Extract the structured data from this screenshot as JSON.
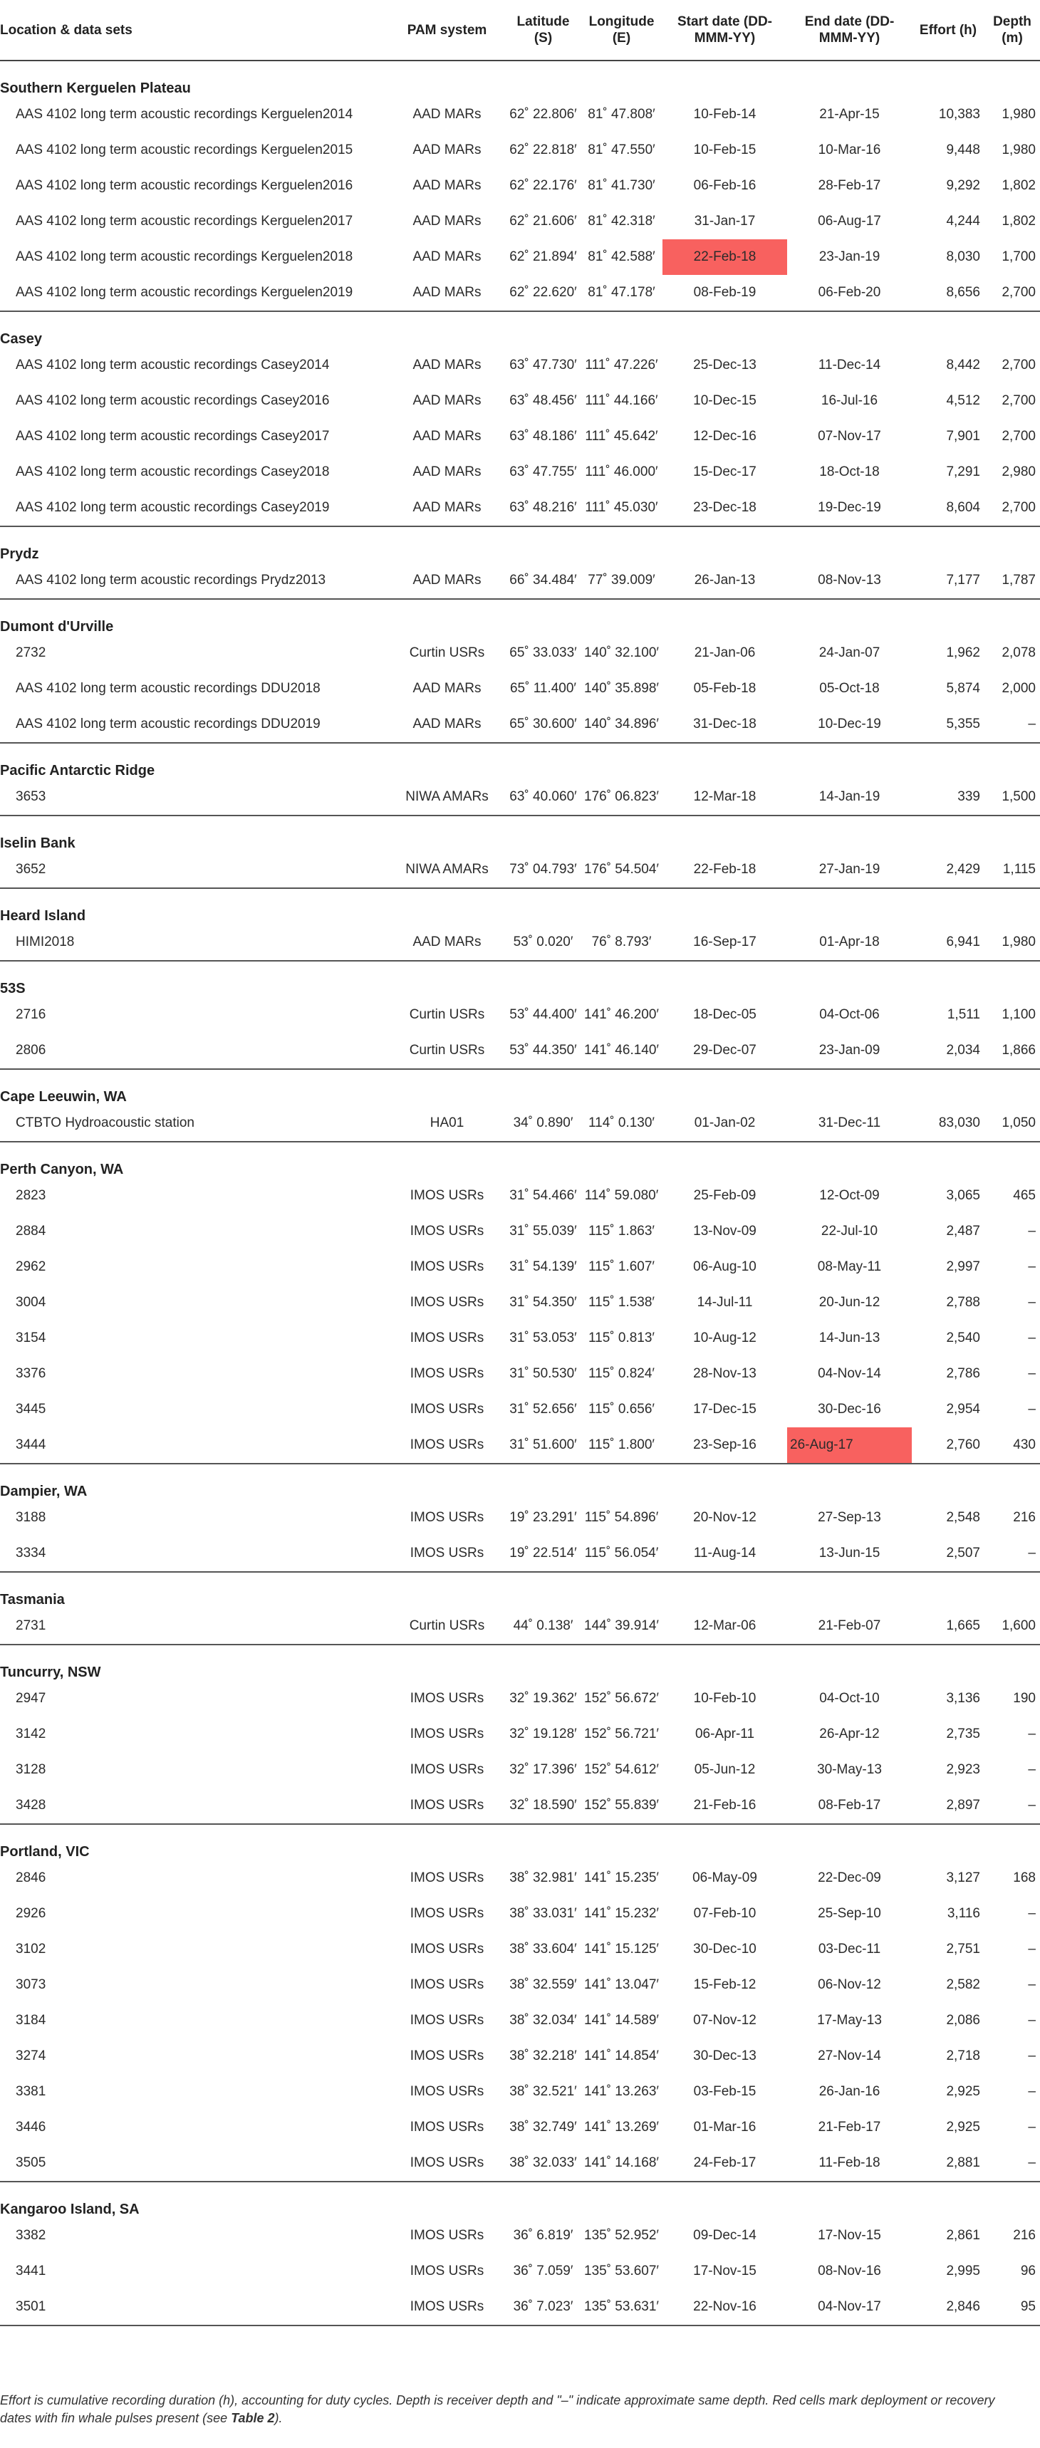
{
  "headers": {
    "location": "Location & data sets",
    "pam": "PAM system",
    "lat": "Latitude (S)",
    "lon": "Longitude (E)",
    "start": "Start date (DD-MMM-YY)",
    "end": "End date (DD-MMM-YY)",
    "effort": "Effort (h)",
    "depth": "Depth (m)"
  },
  "sections": [
    {
      "name": "Southern Kerguelen Plateau",
      "rows": [
        {
          "loc": "AAS 4102 long term acoustic recordings Kerguelen2014",
          "pam": "AAD MARs",
          "lat": "62˚ 22.806′",
          "lon": "81˚ 47.808′",
          "start": "10-Feb-14",
          "end": "21-Apr-15",
          "effort": "10,383",
          "depth": "1,980"
        },
        {
          "loc": "AAS 4102 long term acoustic recordings Kerguelen2015",
          "pam": "AAD MARs",
          "lat": "62˚ 22.818′",
          "lon": "81˚ 47.550′",
          "start": "10-Feb-15",
          "end": "10-Mar-16",
          "effort": "9,448",
          "depth": "1,980"
        },
        {
          "loc": "AAS 4102 long term acoustic recordings Kerguelen2016",
          "pam": "AAD MARs",
          "lat": "62˚ 22.176′",
          "lon": "81˚ 41.730′",
          "start": "06-Feb-16",
          "end": "28-Feb-17",
          "effort": "9,292",
          "depth": "1,802"
        },
        {
          "loc": "AAS 4102 long term acoustic recordings Kerguelen2017",
          "pam": "AAD MARs",
          "lat": "62˚ 21.606′",
          "lon": "81˚ 42.318′",
          "start": "31-Jan-17",
          "end": "06-Aug-17",
          "effort": "4,244",
          "depth": "1,802"
        },
        {
          "loc": "AAS 4102 long term acoustic recordings Kerguelen2018",
          "pam": "AAD MARs",
          "lat": "62˚ 21.894′",
          "lon": "81˚ 42.588′",
          "start": "22-Feb-18",
          "end": "23-Jan-19",
          "effort": "8,030",
          "depth": "1,700",
          "red": "start"
        },
        {
          "loc": "AAS 4102 long term acoustic recordings Kerguelen2019",
          "pam": "AAD MARs",
          "lat": "62˚ 22.620′",
          "lon": "81˚ 47.178′",
          "start": "08-Feb-19",
          "end": "06-Feb-20",
          "effort": "8,656",
          "depth": "2,700"
        }
      ]
    },
    {
      "name": "Casey",
      "rows": [
        {
          "loc": "AAS 4102 long term acoustic recordings Casey2014",
          "pam": "AAD MARs",
          "lat": "63˚ 47.730′",
          "lon": "111˚ 47.226′",
          "start": "25-Dec-13",
          "end": "11-Dec-14",
          "effort": "8,442",
          "depth": "2,700"
        },
        {
          "loc": "AAS 4102 long term acoustic recordings Casey2016",
          "pam": "AAD MARs",
          "lat": "63˚ 48.456′",
          "lon": "111˚ 44.166′",
          "start": "10-Dec-15",
          "end": "16-Jul-16",
          "effort": "4,512",
          "depth": "2,700"
        },
        {
          "loc": "AAS 4102 long term acoustic recordings Casey2017",
          "pam": "AAD MARs",
          "lat": "63˚ 48.186′",
          "lon": "111˚ 45.642′",
          "start": "12-Dec-16",
          "end": "07-Nov-17",
          "effort": "7,901",
          "depth": "2,700"
        },
        {
          "loc": "AAS 4102 long term acoustic recordings Casey2018",
          "pam": "AAD MARs",
          "lat": "63˚ 47.755′",
          "lon": "111˚ 46.000′",
          "start": "15-Dec-17",
          "end": "18-Oct-18",
          "effort": "7,291",
          "depth": "2,980"
        },
        {
          "loc": "AAS 4102 long term acoustic recordings Casey2019",
          "pam": "AAD MARs",
          "lat": "63˚ 48.216′",
          "lon": "111˚ 45.030′",
          "start": "23-Dec-18",
          "end": "19-Dec-19",
          "effort": "8,604",
          "depth": "2,700"
        }
      ]
    },
    {
      "name": "Prydz",
      "rows": [
        {
          "loc": "AAS 4102 long term acoustic recordings Prydz2013",
          "pam": "AAD MARs",
          "lat": "66˚ 34.484′",
          "lon": "77˚ 39.009′",
          "start": "26-Jan-13",
          "end": "08-Nov-13",
          "effort": "7,177",
          "depth": "1,787"
        }
      ]
    },
    {
      "name": "Dumont d'Urville",
      "rows": [
        {
          "loc": "2732",
          "pam": "Curtin USRs",
          "lat": "65˚ 33.033′",
          "lon": "140˚ 32.100′",
          "start": "21-Jan-06",
          "end": "24-Jan-07",
          "effort": "1,962",
          "depth": "2,078"
        },
        {
          "loc": "AAS 4102 long term acoustic recordings DDU2018",
          "pam": "AAD MARs",
          "lat": "65˚ 11.400′",
          "lon": "140˚ 35.898′",
          "start": "05-Feb-18",
          "end": "05-Oct-18",
          "effort": "5,874",
          "depth": "2,000"
        },
        {
          "loc": "AAS 4102 long term acoustic recordings DDU2019",
          "pam": "AAD MARs",
          "lat": "65˚ 30.600′",
          "lon": "140˚ 34.896′",
          "start": "31-Dec-18",
          "end": "10-Dec-19",
          "effort": "5,355",
          "depth": "–"
        }
      ]
    },
    {
      "name": "Pacific Antarctic Ridge",
      "rows": [
        {
          "loc": "3653",
          "pam": "NIWA AMARs",
          "lat": "63˚ 40.060′",
          "lon": "176˚ 06.823′",
          "start": "12-Mar-18",
          "end": "14-Jan-19",
          "effort": "339",
          "depth": "1,500"
        }
      ]
    },
    {
      "name": "Iselin Bank",
      "rows": [
        {
          "loc": "3652",
          "pam": "NIWA AMARs",
          "lat": "73˚ 04.793′",
          "lon": "176˚ 54.504′",
          "start": "22-Feb-18",
          "end": "27-Jan-19",
          "effort": "2,429",
          "depth": "1,115"
        }
      ]
    },
    {
      "name": "Heard Island",
      "rows": [
        {
          "loc": "HIMI2018",
          "pam": "AAD MARs",
          "lat": "53˚ 0.020′",
          "lon": "76˚ 8.793′",
          "start": "16-Sep-17",
          "end": "01-Apr-18",
          "effort": "6,941",
          "depth": "1,980"
        }
      ]
    },
    {
      "name": "53S",
      "rows": [
        {
          "loc": "2716",
          "pam": "Curtin USRs",
          "lat": "53˚ 44.400′",
          "lon": "141˚ 46.200′",
          "start": "18-Dec-05",
          "end": "04-Oct-06",
          "effort": "1,511",
          "depth": "1,100"
        },
        {
          "loc": "2806",
          "pam": "Curtin USRs",
          "lat": "53˚ 44.350′",
          "lon": "141˚ 46.140′",
          "start": "29-Dec-07",
          "end": "23-Jan-09",
          "effort": "2,034",
          "depth": "1,866"
        }
      ]
    },
    {
      "name": "Cape Leeuwin, WA",
      "rows": [
        {
          "loc": "CTBTO Hydroacoustic station",
          "pam": "HA01",
          "lat": "34˚ 0.890′",
          "lon": "114˚ 0.130′",
          "start": "01-Jan-02",
          "end": "31-Dec-11",
          "effort": "83,030",
          "depth": "1,050"
        }
      ]
    },
    {
      "name": "Perth Canyon, WA",
      "rows": [
        {
          "loc": "2823",
          "pam": "IMOS USRs",
          "lat": "31˚ 54.466′",
          "lon": "114˚ 59.080′",
          "start": "25-Feb-09",
          "end": "12-Oct-09",
          "effort": "3,065",
          "depth": "465"
        },
        {
          "loc": "2884",
          "pam": "IMOS USRs",
          "lat": "31˚ 55.039′",
          "lon": "115˚ 1.863′",
          "start": "13-Nov-09",
          "end": "22-Jul-10",
          "effort": "2,487",
          "depth": "–"
        },
        {
          "loc": "2962",
          "pam": "IMOS USRs",
          "lat": "31˚ 54.139′",
          "lon": "115˚ 1.607′",
          "start": "06-Aug-10",
          "end": "08-May-11",
          "effort": "2,997",
          "depth": "–"
        },
        {
          "loc": "3004",
          "pam": "IMOS USRs",
          "lat": "31˚ 54.350′",
          "lon": "115˚ 1.538′",
          "start": "14-Jul-11",
          "end": "20-Jun-12",
          "effort": "2,788",
          "depth": "–"
        },
        {
          "loc": "3154",
          "pam": "IMOS USRs",
          "lat": "31˚ 53.053′",
          "lon": "115˚ 0.813′",
          "start": "10-Aug-12",
          "end": "14-Jun-13",
          "effort": "2,540",
          "depth": "–"
        },
        {
          "loc": "3376",
          "pam": "IMOS USRs",
          "lat": "31˚ 50.530′",
          "lon": "115˚ 0.824′",
          "start": "28-Nov-13",
          "end": "04-Nov-14",
          "effort": "2,786",
          "depth": "–"
        },
        {
          "loc": "3445",
          "pam": "IMOS USRs",
          "lat": "31˚ 52.656′",
          "lon": "115˚ 0.656′",
          "start": "17-Dec-15",
          "end": "30-Dec-16",
          "effort": "2,954",
          "depth": "–"
        },
        {
          "loc": "3444",
          "pam": "IMOS USRs",
          "lat": "31˚ 51.600′",
          "lon": "115˚ 1.800′",
          "start": "23-Sep-16",
          "end": "26-Aug-17",
          "effort": "2,760",
          "depth": "430",
          "red": "end"
        }
      ]
    },
    {
      "name": "Dampier, WA",
      "rows": [
        {
          "loc": "3188",
          "pam": "IMOS USRs",
          "lat": "19˚ 23.291′",
          "lon": "115˚ 54.896′",
          "start": "20-Nov-12",
          "end": "27-Sep-13",
          "effort": "2,548",
          "depth": "216"
        },
        {
          "loc": "3334",
          "pam": "IMOS USRs",
          "lat": "19˚ 22.514′",
          "lon": "115˚ 56.054′",
          "start": "11-Aug-14",
          "end": "13-Jun-15",
          "effort": "2,507",
          "depth": "–"
        }
      ]
    },
    {
      "name": "Tasmania",
      "rows": [
        {
          "loc": "2731",
          "pam": "Curtin USRs",
          "lat": "44˚ 0.138′",
          "lon": "144˚ 39.914′",
          "start": "12-Mar-06",
          "end": "21-Feb-07",
          "effort": "1,665",
          "depth": "1,600"
        }
      ]
    },
    {
      "name": "Tuncurry, NSW",
      "rows": [
        {
          "loc": "2947",
          "pam": "IMOS USRs",
          "lat": "32˚ 19.362′",
          "lon": "152˚ 56.672′",
          "start": "10-Feb-10",
          "end": "04-Oct-10",
          "effort": "3,136",
          "depth": "190"
        },
        {
          "loc": "3142",
          "pam": "IMOS USRs",
          "lat": "32˚ 19.128′",
          "lon": "152˚ 56.721′",
          "start": "06-Apr-11",
          "end": "26-Apr-12",
          "effort": "2,735",
          "depth": "–"
        },
        {
          "loc": "3128",
          "pam": "IMOS USRs",
          "lat": "32˚ 17.396′",
          "lon": "152˚ 54.612′",
          "start": "05-Jun-12",
          "end": "30-May-13",
          "effort": "2,923",
          "depth": "–"
        },
        {
          "loc": "3428",
          "pam": "IMOS USRs",
          "lat": "32˚ 18.590′",
          "lon": "152˚ 55.839′",
          "start": "21-Feb-16",
          "end": "08-Feb-17",
          "effort": "2,897",
          "depth": "–"
        }
      ]
    },
    {
      "name": "Portland, VIC",
      "rows": [
        {
          "loc": "2846",
          "pam": "IMOS USRs",
          "lat": "38˚ 32.981′",
          "lon": "141˚ 15.235′",
          "start": "06-May-09",
          "end": "22-Dec-09",
          "effort": "3,127",
          "depth": "168"
        },
        {
          "loc": "2926",
          "pam": "IMOS USRs",
          "lat": "38˚ 33.031′",
          "lon": "141˚ 15.232′",
          "start": "07-Feb-10",
          "end": "25-Sep-10",
          "effort": "3,116",
          "depth": "–"
        },
        {
          "loc": "3102",
          "pam": "IMOS USRs",
          "lat": "38˚ 33.604′",
          "lon": "141˚ 15.125′",
          "start": "30-Dec-10",
          "end": "03-Dec-11",
          "effort": "2,751",
          "depth": "–"
        },
        {
          "loc": "3073",
          "pam": "IMOS USRs",
          "lat": "38˚ 32.559′",
          "lon": "141˚ 13.047′",
          "start": "15-Feb-12",
          "end": "06-Nov-12",
          "effort": "2,582",
          "depth": "–"
        },
        {
          "loc": "3184",
          "pam": "IMOS USRs",
          "lat": "38˚ 32.034′",
          "lon": "141˚ 14.589′",
          "start": "07-Nov-12",
          "end": "17-May-13",
          "effort": "2,086",
          "depth": "–"
        },
        {
          "loc": "3274",
          "pam": "IMOS USRs",
          "lat": "38˚ 32.218′",
          "lon": "141˚ 14.854′",
          "start": "30-Dec-13",
          "end": "27-Nov-14",
          "effort": "2,718",
          "depth": "–"
        },
        {
          "loc": "3381",
          "pam": "IMOS USRs",
          "lat": "38˚ 32.521′",
          "lon": "141˚ 13.263′",
          "start": "03-Feb-15",
          "end": "26-Jan-16",
          "effort": "2,925",
          "depth": "–"
        },
        {
          "loc": "3446",
          "pam": "IMOS USRs",
          "lat": "38˚ 32.749′",
          "lon": "141˚ 13.269′",
          "start": "01-Mar-16",
          "end": "21-Feb-17",
          "effort": "2,925",
          "depth": "–"
        },
        {
          "loc": "3505",
          "pam": "IMOS USRs",
          "lat": "38˚ 32.033′",
          "lon": "141˚ 14.168′",
          "start": "24-Feb-17",
          "end": "11-Feb-18",
          "effort": "2,881",
          "depth": "–"
        }
      ]
    },
    {
      "name": "Kangaroo Island, SA",
      "rows": [
        {
          "loc": "3382",
          "pam": "IMOS USRs",
          "lat": "36˚ 6.819′",
          "lon": "135˚ 52.952′",
          "start": "09-Dec-14",
          "end": "17-Nov-15",
          "effort": "2,861",
          "depth": "216"
        },
        {
          "loc": "3441",
          "pam": "IMOS USRs",
          "lat": "36˚ 7.059′",
          "lon": "135˚ 53.607′",
          "start": "17-Nov-15",
          "end": "08-Nov-16",
          "effort": "2,995",
          "depth": "96"
        },
        {
          "loc": "3501",
          "pam": "IMOS USRs",
          "lat": "36˚ 7.023′",
          "lon": "135˚ 53.631′",
          "start": "22-Nov-16",
          "end": "04-Nov-17",
          "effort": "2,846",
          "depth": "95"
        }
      ]
    }
  ],
  "footnote": {
    "text": "Effort is cumulative recording duration (h), accounting for duty cycles. Depth is receiver depth and \"–\" indicate approximate same depth. Red cells mark deployment or recovery dates with fin whale pulses present (see ",
    "ref": "Table 2",
    "end": ")."
  },
  "colors": {
    "highlight": "#f8615f",
    "rule": "#444444",
    "text": "#2b2b2b"
  }
}
